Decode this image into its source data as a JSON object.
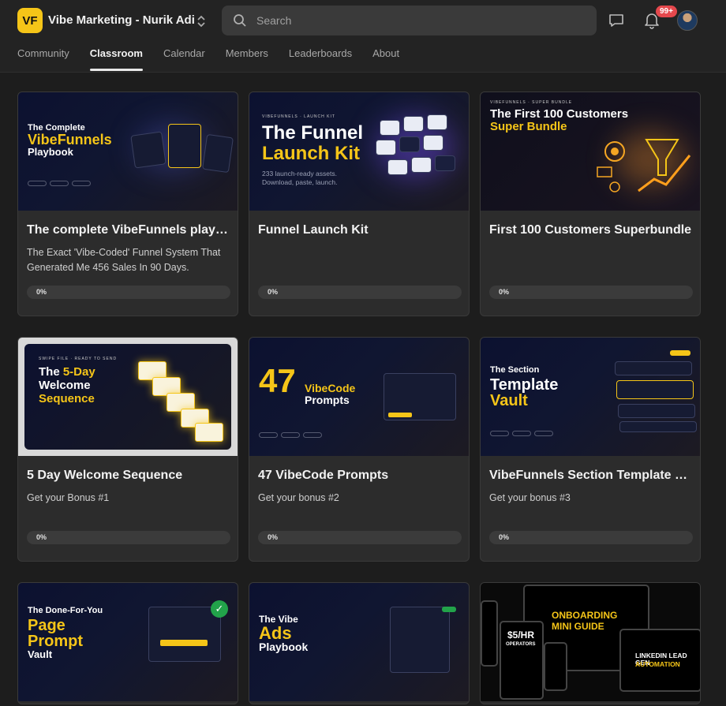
{
  "header": {
    "logo_text": "VF",
    "group_name": "Vibe Marketing - Nurik Adi",
    "search_placeholder": "Search",
    "notification_count": "99+"
  },
  "tabs": [
    {
      "label": "Community",
      "active": false
    },
    {
      "label": "Classroom",
      "active": true
    },
    {
      "label": "Calendar",
      "active": false
    },
    {
      "label": "Members",
      "active": false
    },
    {
      "label": "Leaderboards",
      "active": false
    },
    {
      "label": "About",
      "active": false
    }
  ],
  "courses": [
    {
      "title": "The complete VibeFunnels playbook",
      "description": "The Exact 'Vibe-Coded' Funnel System That Generated Me 456 Sales In 90 Days.",
      "progress_label": "0%",
      "progress": 0,
      "thumb": {
        "line1": "The Complete",
        "line2": "VibeFunnels",
        "line3": "Playbook"
      }
    },
    {
      "title": "Funnel Launch Kit",
      "description": "",
      "progress_label": "0%",
      "progress": 0,
      "thumb": {
        "kicker": "VIBEFUNNELS · LAUNCH KIT",
        "line1": "The Funnel",
        "line2": "Launch Kit",
        "sub1": "233 launch-ready assets.",
        "sub2": "Download, paste, launch."
      }
    },
    {
      "title": "First 100 Customers Superbundle",
      "description": "",
      "progress_label": "0%",
      "progress": 0,
      "thumb": {
        "kicker": "VIBEFUNNELS · SUPER BUNDLE",
        "line1": "The First 100 Customers",
        "line2": "Super Bundle"
      }
    },
    {
      "title": "5 Day Welcome Sequence",
      "description": "Get your Bonus #1",
      "progress_label": "0%",
      "progress": 0,
      "thumb": {
        "kicker": "SWIPE FILE · READY TO SEND",
        "line1": "The",
        "line1b": "5-Day",
        "line2": "Welcome",
        "line3": "Sequence"
      }
    },
    {
      "title": "47 VibeCode Prompts",
      "description": "Get your bonus #2",
      "progress_label": "0%",
      "progress": 0,
      "thumb": {
        "number": "47",
        "line1": "VibeCode",
        "line2": "Prompts"
      }
    },
    {
      "title": "VibeFunnels Section Template Vault",
      "description": "Get your bonus #3",
      "progress_label": "0%",
      "progress": 0,
      "thumb": {
        "line1": "The Section",
        "line2": "Template",
        "line3": "Vault"
      }
    },
    {
      "title": "",
      "description": "",
      "progress_label": "",
      "progress": 0,
      "thumb": {
        "line1": "The Done-For-You",
        "line2": "Page",
        "line3": "Prompt",
        "line4": "Vault"
      }
    },
    {
      "title": "",
      "description": "",
      "progress_label": "",
      "progress": 0,
      "thumb": {
        "line1": "The Vibe",
        "line2": "Ads",
        "line3": "Playbook"
      }
    },
    {
      "title": "",
      "description": "",
      "progress_label": "",
      "progress": 0,
      "thumb": {
        "line1": "ONBOARDING",
        "line2": "MINI GUIDE",
        "line3": "$5/HR",
        "line4": "OPERATORS",
        "line5": "LINKEDIN LEAD GEN",
        "line6": "AUTOMATION"
      }
    }
  ]
}
